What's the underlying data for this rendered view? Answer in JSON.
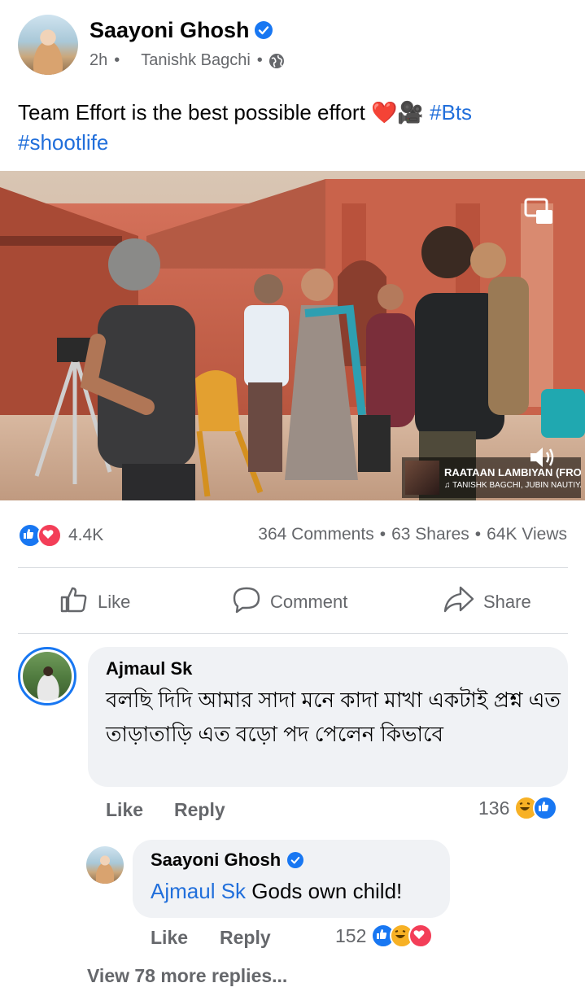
{
  "post": {
    "author": "Saayoni Ghosh",
    "time": "2h",
    "tagged": "Tanishk Bagchi",
    "text_main": "Team Effort is the best possible effort ❤️🎥",
    "hashtag1": "#Bts",
    "hashtag2": "#shootlife"
  },
  "video": {
    "song_title": "RAATAAN LAMBIYAN (FROM...",
    "song_artists": "♫ TANISHK BAGCHI, JUBIN NAUTIYAL, ASE..."
  },
  "stats": {
    "reactions": "4.4K",
    "comments": "364 Comments",
    "shares": "63 Shares",
    "views": "64K Views"
  },
  "actions": {
    "like": "Like",
    "comment": "Comment",
    "share": "Share"
  },
  "comment1": {
    "name": "Ajmaul Sk",
    "text": "বলছি দিদি আমার সাদা মনে কাদা মাখা একটাই প্রশ্ন এত তাড়াতাড়ি এত বড়ো পদ পেলেন কিভাবে",
    "like": "Like",
    "reply": "Reply",
    "count": "136"
  },
  "reply1": {
    "name": "Saayoni Ghosh",
    "mention": "Ajmaul Sk",
    "text": "Gods own child!",
    "like": "Like",
    "reply": "Reply",
    "count": "152"
  },
  "more_replies": "View 78 more replies...",
  "colors": {
    "accent": "#1877f2",
    "hashtag": "#216fdb",
    "meta": "#65676b",
    "bubble": "#f0f2f5",
    "love": "#f33e58",
    "haha": "#f7b125"
  }
}
